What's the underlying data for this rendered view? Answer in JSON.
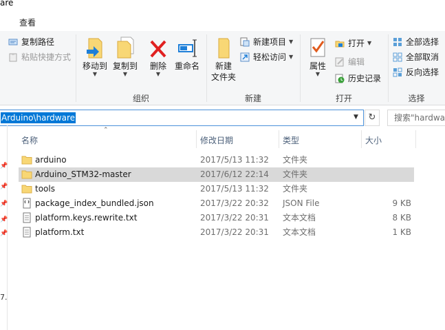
{
  "window": {
    "title_fragment": "are"
  },
  "menu": {
    "view_tab": "查看"
  },
  "ribbon": {
    "organize": {
      "label": "组织",
      "copy_path": "复制路径",
      "paste_shortcut": "粘贴快捷方式",
      "move_to": "移动到",
      "copy_to": "复制到",
      "delete": "删除",
      "rename": "重命名"
    },
    "new": {
      "label": "新建",
      "new_folder": "新建\n文件夹",
      "new_item": "新建项目",
      "easy_access": "轻松访问"
    },
    "open": {
      "label": "打开",
      "properties": "属性",
      "open": "打开",
      "edit": "编辑",
      "history": "历史记录"
    },
    "select": {
      "label": "选择",
      "select_all": "全部选择",
      "select_none": "全部取消",
      "invert": "反向选择"
    }
  },
  "address": {
    "path": "Arduino\\hardware",
    "search_placeholder": "搜索\"hardware\""
  },
  "nav": {
    "fragment": "7."
  },
  "columns": {
    "name": "名称",
    "date": "修改日期",
    "type": "类型",
    "size": "大小"
  },
  "files": [
    {
      "name": "arduino",
      "date": "2017/5/13 11:32",
      "type": "文件夹",
      "size": "",
      "icon": "folder-icon"
    },
    {
      "name": "Arduino_STM32-master",
      "date": "2017/6/12 22:14",
      "type": "文件夹",
      "size": "",
      "icon": "folder-icon",
      "selected": true
    },
    {
      "name": "tools",
      "date": "2017/5/13 11:32",
      "type": "文件夹",
      "size": "",
      "icon": "folder-icon"
    },
    {
      "name": "package_index_bundled.json",
      "date": "2017/3/22 20:32",
      "type": "JSON File",
      "size": "9 KB",
      "icon": "json-file-icon"
    },
    {
      "name": "platform.keys.rewrite.txt",
      "date": "2017/3/22 20:31",
      "type": "文本文档",
      "size": "8 KB",
      "icon": "text-file-icon"
    },
    {
      "name": "platform.txt",
      "date": "2017/3/22 20:31",
      "type": "文本文档",
      "size": "1 KB",
      "icon": "text-file-icon"
    }
  ],
  "colors": {
    "accent": "#0078d7",
    "selected_row": "#d9d9d9",
    "folder": "#f8d775"
  }
}
